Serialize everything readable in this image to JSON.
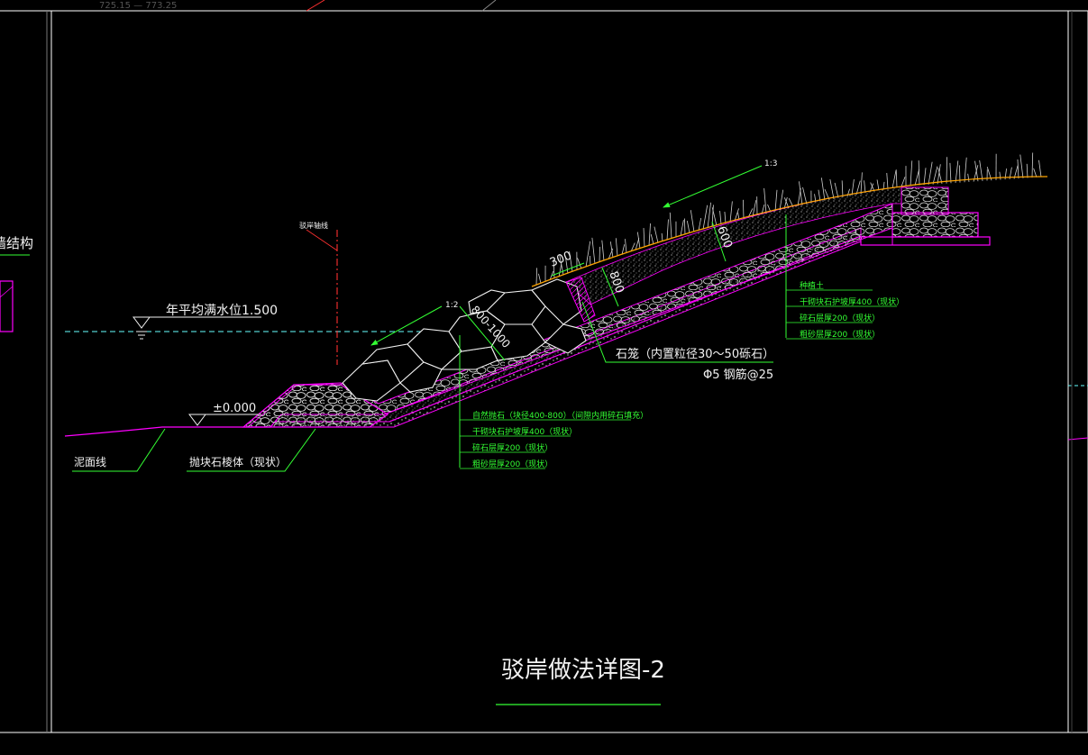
{
  "drawing": {
    "title": "驳岸做法详图-2",
    "left_clip_label": "墙结构",
    "top_clip_text": "725.15 — 773.25",
    "center_axis_label": "驳岸轴线",
    "water_level_label": "年平均满水位1.500",
    "datum_label": "±0.000",
    "mud_line_label": "泥面线",
    "riprap_label": "抛块石棱体（现状）",
    "slope_upper": "1:3",
    "slope_lower": "1:2",
    "dim_300": "300",
    "dim_800": "800",
    "dim_600": "600",
    "dim_diag": "800-1000",
    "gabion_label": "石笼（内置粒径30～50砾石）",
    "rebar_label": "Φ5 钢筋@25",
    "upper_callouts": [
      "种植土",
      "干砌块石护坡厚400（现状）",
      "碎石层厚200（现状）",
      "粗砂层厚200（现状）"
    ],
    "lower_callouts": [
      "自然抛石（块径400-800）（间隙内用碎石填充）",
      "干砌块石护坡厚400（现状）",
      "碎石层厚200（现状）",
      "粗砂层厚200（现状）"
    ]
  },
  "colors": {
    "background": "#000000",
    "frame": "#ffffff",
    "magenta": "#ff00ff",
    "green": "#33ff33",
    "cyan": "#66ffff",
    "red": "#ff3030",
    "orange": "#ffa500",
    "text": "#f2f2f2"
  }
}
